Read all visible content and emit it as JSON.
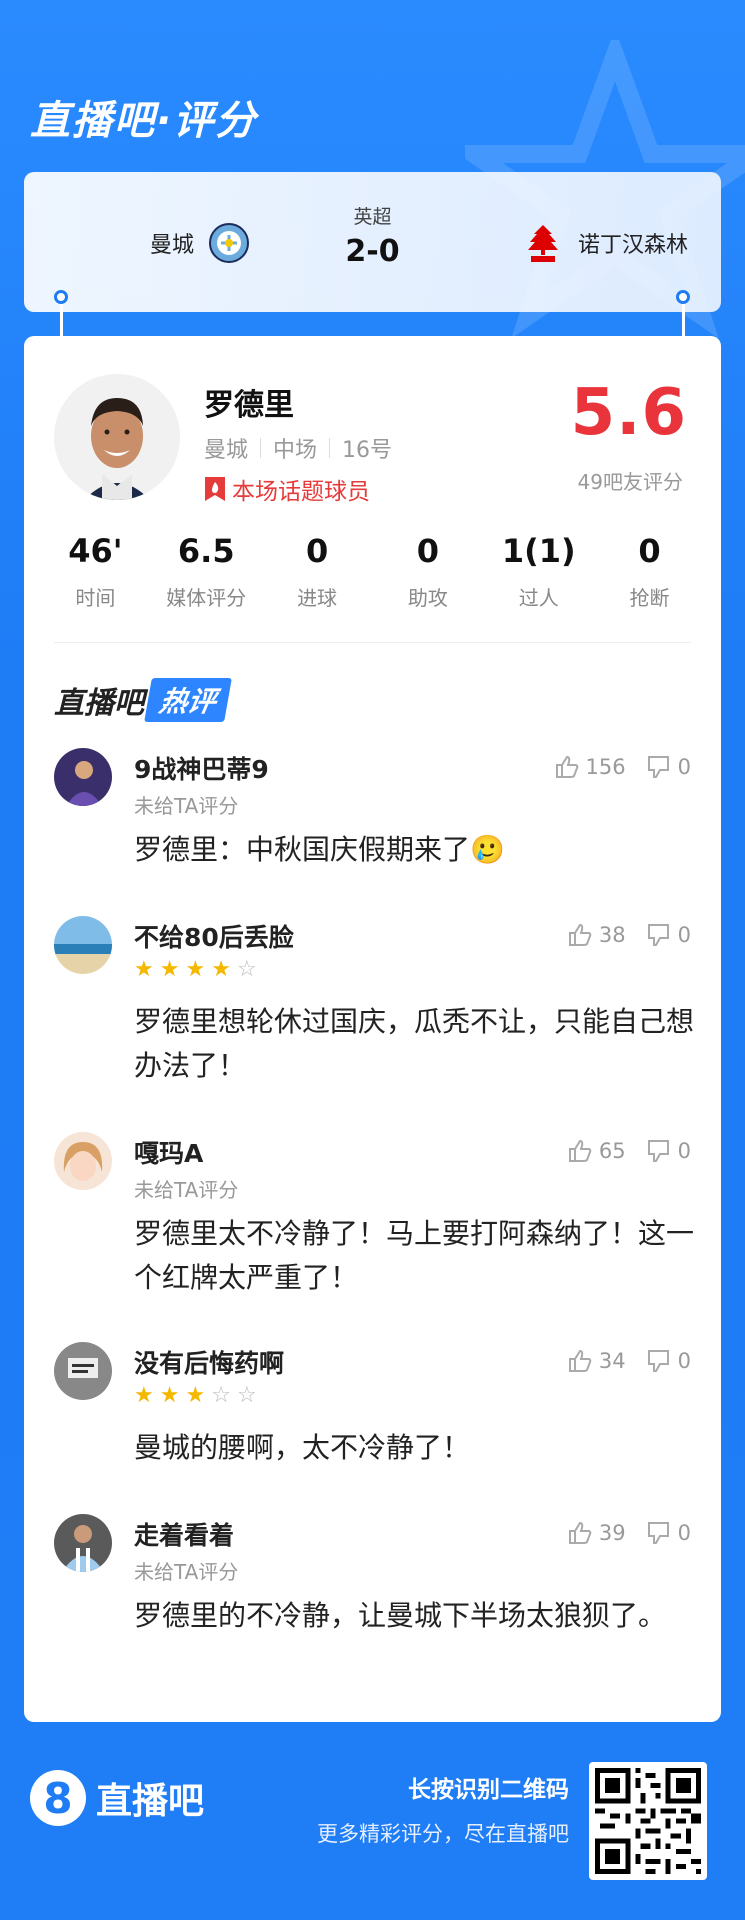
{
  "header": {
    "title": "直播吧·评分"
  },
  "match": {
    "league": "英超",
    "score": "2-0",
    "home": {
      "name": "曼城",
      "logo_icon": "man-city-crest"
    },
    "away": {
      "name": "诺丁汉森林",
      "logo_icon": "nottingham-forest-crest"
    }
  },
  "player": {
    "name": "罗德里",
    "team": "曼城",
    "position": "中场",
    "number": "16号",
    "tag": "本场话题球员",
    "rating": "5.6",
    "rating_count": "49吧友评分"
  },
  "stats": [
    {
      "value": "46'",
      "label": "时间"
    },
    {
      "value": "6.5",
      "label": "媒体评分"
    },
    {
      "value": "0",
      "label": "进球"
    },
    {
      "value": "0",
      "label": "助攻"
    },
    {
      "value": "1(1)",
      "label": "过人"
    },
    {
      "value": "0",
      "label": "抢断"
    }
  ],
  "hot_header": {
    "part1": "直播吧",
    "part2": "热评"
  },
  "comments": [
    {
      "user": "9战神巴蒂9",
      "sub": "未给TA评分",
      "stars": null,
      "text": "罗德里：中秋国庆假期来了🥲",
      "likes": "156",
      "dislikes": "0"
    },
    {
      "user": "不给80后丢脸",
      "sub": "",
      "stars": 4,
      "text": "罗德里想轮休过国庆，瓜秃不让，只能自己想办法了！",
      "likes": "38",
      "dislikes": "0"
    },
    {
      "user": "嘎玛A",
      "sub": "未给TA评分",
      "stars": null,
      "text": "罗德里太不冷静了！马上要打阿森纳了！这一个红牌太严重了！",
      "likes": "65",
      "dislikes": "0"
    },
    {
      "user": "没有后悔药啊",
      "sub": "",
      "stars": 3,
      "text": "曼城的腰啊，太不冷静了！",
      "likes": "34",
      "dislikes": "0"
    },
    {
      "user": "走着看着",
      "sub": "未给TA评分",
      "stars": null,
      "text": "罗德里的不冷静，让曼城下半场太狼狈了。",
      "likes": "39",
      "dislikes": "0"
    }
  ],
  "footer": {
    "logo_digit": "8",
    "logo_text": "直播吧",
    "cta_line1": "长按识别二维码",
    "cta_line2": "更多精彩评分，尽在直播吧"
  },
  "colors": {
    "brand_blue": "#1e7cf5",
    "rating_red": "#e8343a",
    "star_gold": "#f5b800"
  }
}
